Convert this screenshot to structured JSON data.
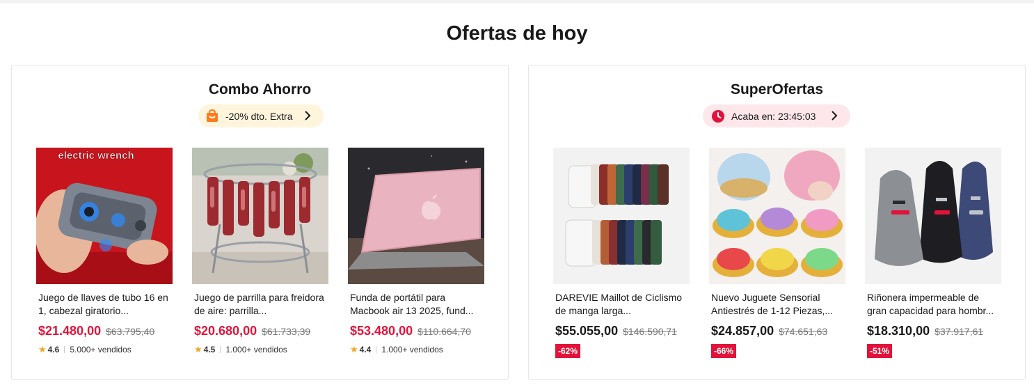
{
  "section": {
    "title": "Ofertas de hoy"
  },
  "combo": {
    "title": "Combo Ahorro",
    "pill": "-20% dto. Extra",
    "products": [
      {
        "title": "Juego de llaves de tubo 16 en 1, cabezal giratorio...",
        "price": "$21.480,00",
        "old_price": "$63.795,40",
        "rating": "4.6",
        "sold": "5.000+ vendidos",
        "image_text": "electric wrench"
      },
      {
        "title": "Juego de parrilla para freidora de aire: parrilla...",
        "price": "$20.680,00",
        "old_price": "$61.733,39",
        "rating": "4.5",
        "sold": "1.000+ vendidos"
      },
      {
        "title": "Funda de portátil para Macbook air 13 2025, fund...",
        "price": "$53.480,00",
        "old_price": "$110.664,70",
        "rating": "4.4",
        "sold": "1.000+ vendidos"
      }
    ]
  },
  "super": {
    "title": "SuperOfertas",
    "pill": "Acaba en: 23:45:03",
    "products": [
      {
        "title": "DAREVIE Maillot de Ciclismo de manga larga...",
        "price": "$55.055,00",
        "old_price": "$146.590,71",
        "discount": "-62%"
      },
      {
        "title": "Nuevo Juguete Sensorial Antiestrés de 1-12 Piezas,...",
        "price": "$24.857,00",
        "old_price": "$74.651,63",
        "discount": "-66%"
      },
      {
        "title": "Riñonera impermeable de gran capacidad para hombr...",
        "price": "$18.310,00",
        "old_price": "$37.917,61",
        "discount": "-51%"
      }
    ]
  },
  "colors": {
    "accent_red": "#e1133a",
    "pill_orange_bg": "#fff4dc",
    "pill_red_bg": "#fde7ea"
  },
  "icons": {
    "combo_pill": "shopping-bag-icon",
    "super_pill": "clock-icon",
    "chevron": "chevron-right-icon",
    "star": "star-icon"
  }
}
